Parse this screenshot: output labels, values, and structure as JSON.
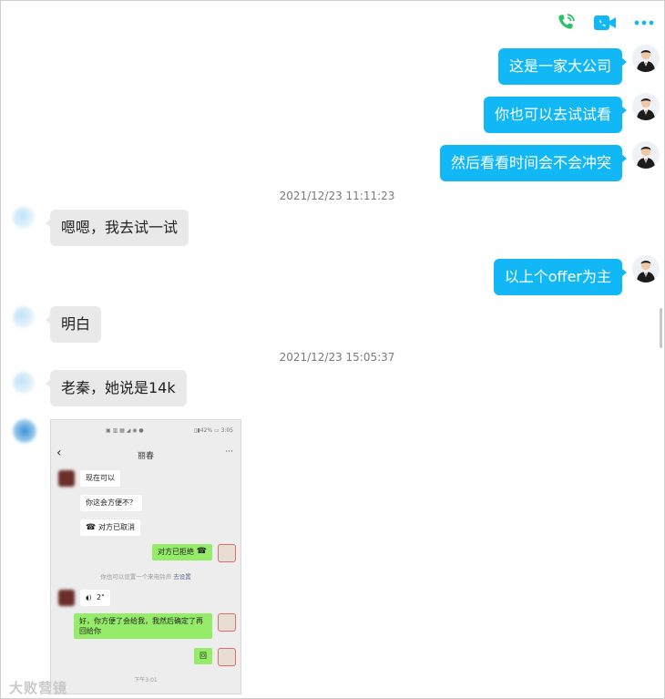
{
  "toolbar": {
    "voice_call_icon": "phone-icon",
    "video_call_icon": "video-icon",
    "more_icon": "more-dots-icon",
    "voice_color": "#2ac169",
    "video_color": "#12b7f5",
    "more_color": "#12b7f5"
  },
  "messages": [
    {
      "dir": "out",
      "text": "这是一家大公司"
    },
    {
      "dir": "out",
      "text": "你也可以去试试看"
    },
    {
      "dir": "out",
      "text": "然后看看时间会不会冲突"
    },
    {
      "dir": "in",
      "text": "嗯嗯，我去试一试"
    },
    {
      "dir": "out",
      "text": "以上个offer为主"
    },
    {
      "dir": "in",
      "text": "明白"
    },
    {
      "dir": "in",
      "text": "老秦，她说是14k"
    }
  ],
  "timestamps": [
    "2021/12/23 11:11:23",
    "2021/12/23 15:05:37"
  ],
  "screenshot": {
    "status_left": "▣ ▥ ▦ ◢ ◉ ●",
    "status_right": "▯▮42% ▭ 3:05",
    "title": "丽春",
    "back_glyph": "‹",
    "more_glyph": "···",
    "msgs": [
      {
        "dir": "in",
        "text": "现在可以"
      },
      {
        "dir": "in",
        "text": "你这会方便不？"
      },
      {
        "dir": "in",
        "text": "对方已取消"
      },
      {
        "dir": "out",
        "text": "对方已拒绝"
      },
      {
        "dir": "in",
        "text": "2\""
      },
      {
        "dir": "out",
        "text": "好，你方便了会给我，我然后确定了再回给你"
      },
      {
        "dir": "out",
        "text": "回"
      }
    ],
    "note_text": "你也可以设置一个来电铃声",
    "note_link": "去设置",
    "time": "下午3:01"
  },
  "watermark": "大败营镜",
  "colors": {
    "outgoing_bubble": "#12b7f5",
    "incoming_bubble": "#e9e9e9",
    "wechat_green": "#95ec69"
  }
}
